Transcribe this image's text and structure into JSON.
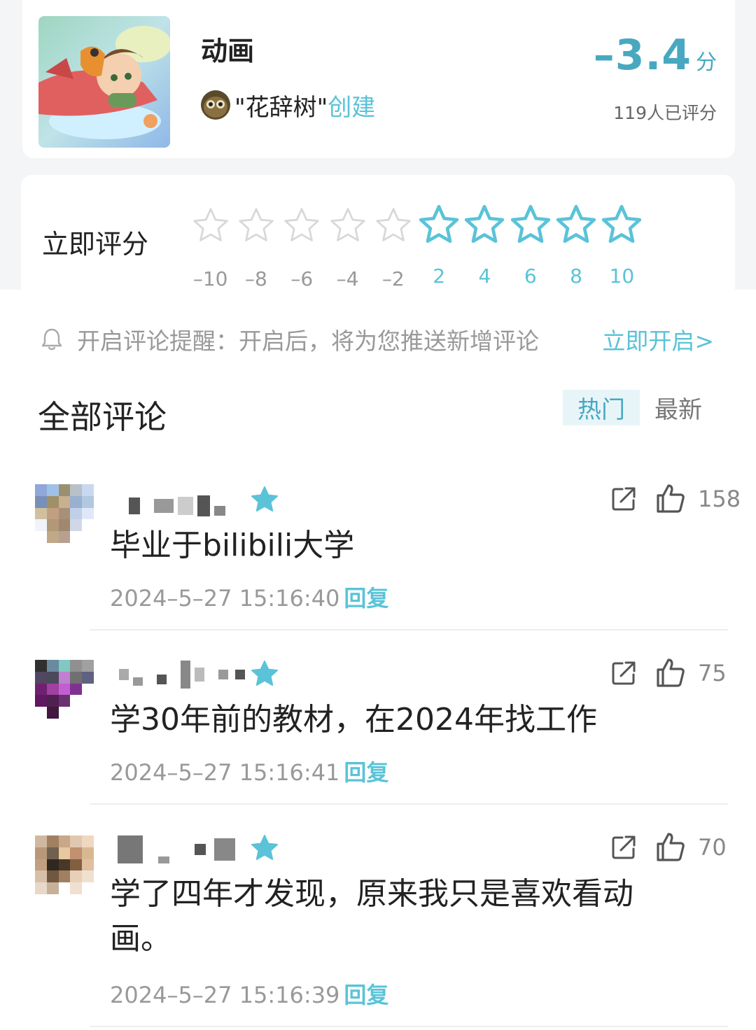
{
  "header": {
    "title": "动画",
    "creator_name": "\"花辞树\"",
    "creator_suffix": "创建",
    "score": "–3.4",
    "score_unit": "分",
    "raters": "119人已评分"
  },
  "rating": {
    "label": "立即评分",
    "values": [
      "–10",
      "–8",
      "–6",
      "–4",
      "–2",
      "2",
      "4",
      "6",
      "8",
      "10"
    ],
    "negative_color": "#999999",
    "positive_color": "#5ac3d8"
  },
  "reminder": {
    "text": "开启评论提醒：开启后，将为您推送新增评论",
    "link": "立即开启>"
  },
  "comments_section": {
    "title": "全部评论",
    "tabs": [
      {
        "label": "热门",
        "active": true
      },
      {
        "label": "最新",
        "active": false
      }
    ]
  },
  "comments": [
    {
      "text": "毕业于bilibili大学",
      "time": "2024–5–27 15:16:40",
      "reply": "回复",
      "likes": "158"
    },
    {
      "text": "学30年前的教材，在2024年找工作",
      "time": "2024–5–27 15:16:41",
      "reply": "回复",
      "likes": "75"
    },
    {
      "text": "学了四年才发现，原来我只是喜欢看动画。",
      "time": "2024–5–27 15:16:39",
      "reply": "回复",
      "likes": "70"
    }
  ],
  "icons": {
    "star": "star-icon",
    "share": "share-icon",
    "like": "thumbs-up-icon",
    "bell": "bell-icon"
  },
  "colors": {
    "accent": "#5ac3d8",
    "score": "#48a8c0"
  }
}
